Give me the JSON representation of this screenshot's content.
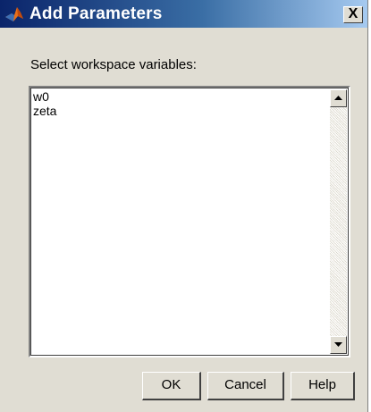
{
  "window": {
    "title": "Add Parameters",
    "close_label": "X",
    "icon": "matlab-logo-icon"
  },
  "prompt": "Select workspace variables:",
  "variables": [
    "w0",
    "zeta"
  ],
  "buttons": {
    "ok": "OK",
    "cancel": "Cancel",
    "help": "Help"
  },
  "colors": {
    "titlebar_start": "#0a246a",
    "titlebar_end": "#a6caf0",
    "dialog_bg": "#e0ddd3"
  }
}
